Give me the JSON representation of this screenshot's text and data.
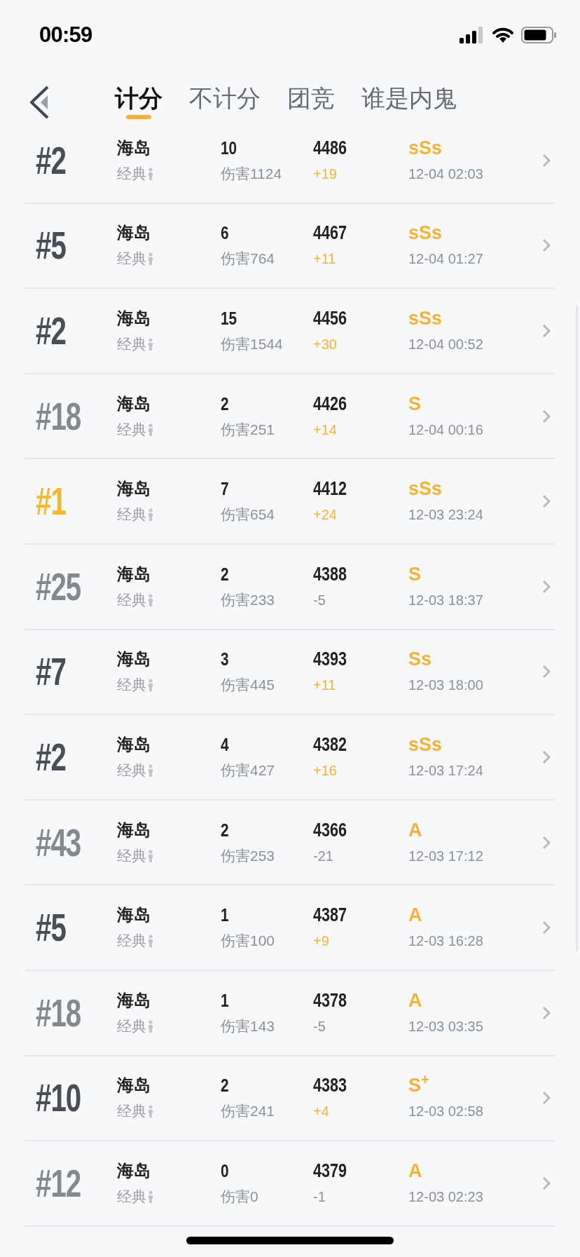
{
  "status_bar": {
    "time": "00:59"
  },
  "tabs": [
    {
      "label": "计分",
      "selected": true
    },
    {
      "label": "不计分",
      "selected": false
    },
    {
      "label": "团竞",
      "selected": false
    },
    {
      "label": "谁是内鬼",
      "selected": false
    }
  ],
  "matches": [
    {
      "rank": "#2",
      "gold": false,
      "dimmed": false,
      "map": "海岛",
      "mode": "经典",
      "kills": "10",
      "damage": "伤害1124",
      "score": "4486",
      "change": "+19",
      "positive": true,
      "grade": "sSs",
      "time": "12-04 02:03"
    },
    {
      "rank": "#5",
      "gold": false,
      "dimmed": false,
      "map": "海岛",
      "mode": "经典",
      "kills": "6",
      "damage": "伤害764",
      "score": "4467",
      "change": "+11",
      "positive": true,
      "grade": "sSs",
      "time": "12-04 01:27"
    },
    {
      "rank": "#2",
      "gold": false,
      "dimmed": false,
      "map": "海岛",
      "mode": "经典",
      "kills": "15",
      "damage": "伤害1544",
      "score": "4456",
      "change": "+30",
      "positive": true,
      "grade": "sSs",
      "time": "12-04 00:52"
    },
    {
      "rank": "#18",
      "gold": false,
      "dimmed": true,
      "map": "海岛",
      "mode": "经典",
      "kills": "2",
      "damage": "伤害251",
      "score": "4426",
      "change": "+14",
      "positive": true,
      "grade": "S",
      "time": "12-04 00:16"
    },
    {
      "rank": "#1",
      "gold": true,
      "map": "海岛",
      "mode": "经典",
      "kills": "7",
      "damage": "伤害654",
      "score": "4412",
      "change": "+24",
      "positive": true,
      "grade": "sSs",
      "time": "12-03 23:24"
    },
    {
      "rank": "#25",
      "gold": false,
      "dimmed": true,
      "map": "海岛",
      "mode": "经典",
      "kills": "2",
      "damage": "伤害233",
      "score": "4388",
      "change": "-5",
      "positive": false,
      "grade": "S",
      "time": "12-03 18:37"
    },
    {
      "rank": "#7",
      "gold": false,
      "dimmed": false,
      "map": "海岛",
      "mode": "经典",
      "kills": "3",
      "damage": "伤害445",
      "score": "4393",
      "change": "+11",
      "positive": true,
      "grade": "Ss",
      "time": "12-03 18:00"
    },
    {
      "rank": "#2",
      "gold": false,
      "dimmed": false,
      "map": "海岛",
      "mode": "经典",
      "kills": "4",
      "damage": "伤害427",
      "score": "4382",
      "change": "+16",
      "positive": true,
      "grade": "sSs",
      "time": "12-03 17:24"
    },
    {
      "rank": "#43",
      "gold": false,
      "dimmed": true,
      "map": "海岛",
      "mode": "经典",
      "kills": "2",
      "damage": "伤害253",
      "score": "4366",
      "change": "-21",
      "positive": false,
      "grade": "A",
      "time": "12-03 17:12"
    },
    {
      "rank": "#5",
      "gold": false,
      "dimmed": false,
      "map": "海岛",
      "mode": "经典",
      "kills": "1",
      "damage": "伤害100",
      "score": "4387",
      "change": "+9",
      "positive": true,
      "grade": "A",
      "time": "12-03 16:28"
    },
    {
      "rank": "#18",
      "gold": false,
      "dimmed": true,
      "map": "海岛",
      "mode": "经典",
      "kills": "1",
      "damage": "伤害143",
      "score": "4378",
      "change": "-5",
      "positive": false,
      "grade": "A",
      "time": "12-03 03:35"
    },
    {
      "rank": "#10",
      "gold": false,
      "dimmed": false,
      "map": "海岛",
      "mode": "经典",
      "kills": "2",
      "damage": "伤害241",
      "score": "4383",
      "change": "+4",
      "positive": true,
      "grade": "S$^{+}$",
      "time": "12-03 02:58"
    },
    {
      "rank": "#12",
      "gold": false,
      "dimmed": true,
      "map": "海岛",
      "mode": "经典",
      "kills": "0",
      "damage": "伤害0",
      "score": "4379",
      "change": "-1",
      "positive": false,
      "grade": "A",
      "time": "12-03 02:23"
    }
  ]
}
